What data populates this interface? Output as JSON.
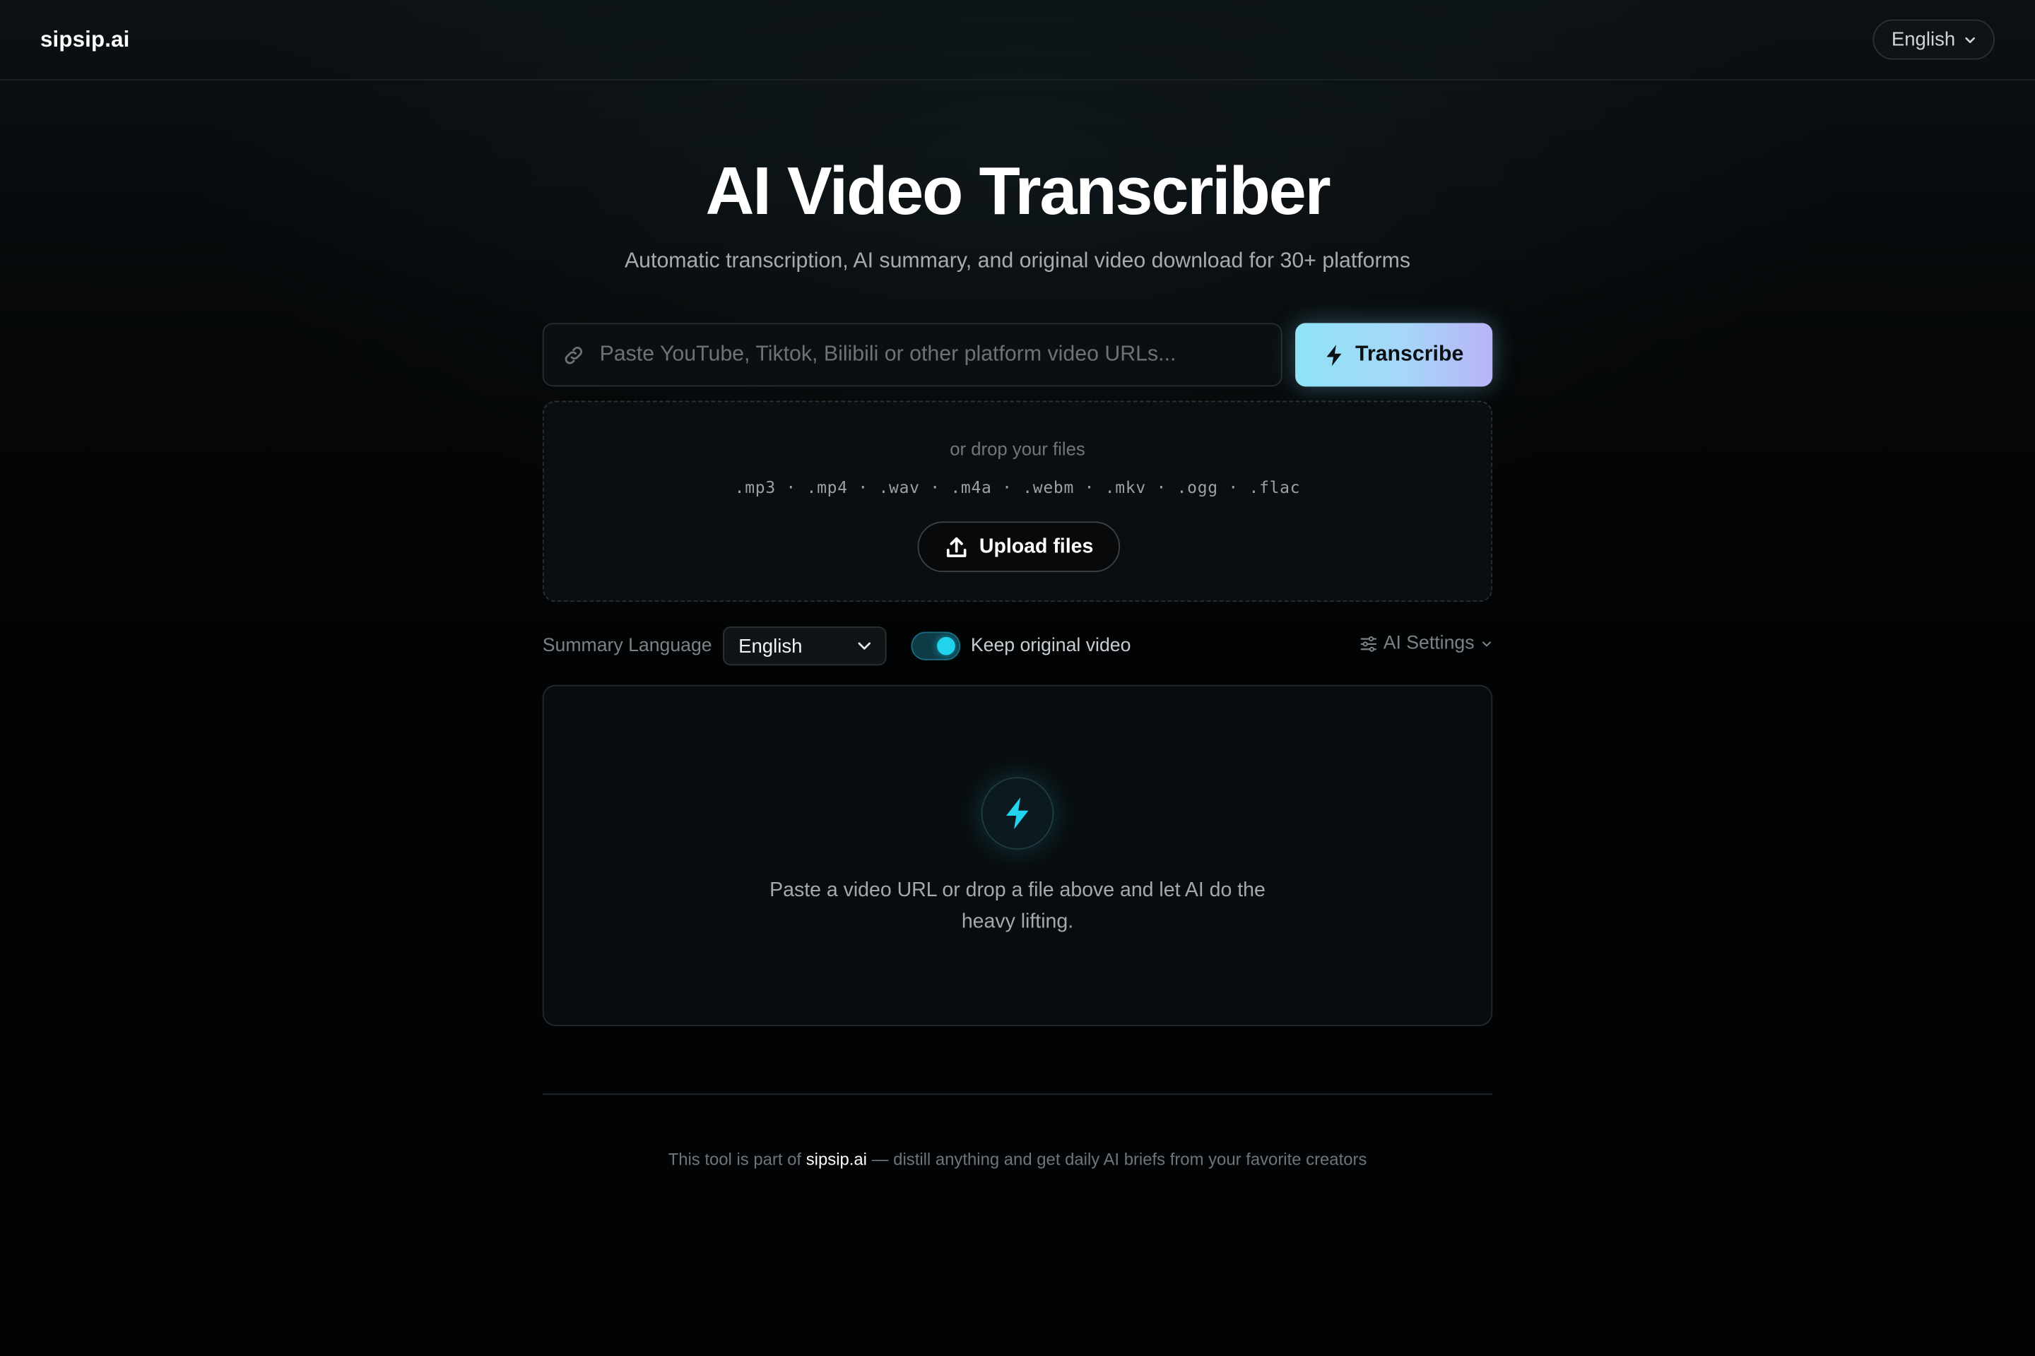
{
  "header": {
    "brand": "sipsip.ai",
    "language": "English"
  },
  "hero": {
    "title": "AI Video Transcriber",
    "subtitle": "Automatic transcription, AI summary, and original video download for 30+ platforms"
  },
  "url_input": {
    "value": "",
    "placeholder": "Paste YouTube, Tiktok, Bilibili or other platform video URLs..."
  },
  "transcribe_button": {
    "label": "Transcribe"
  },
  "dropzone": {
    "hint": "or drop your files",
    "formats": ".mp3 · .mp4 · .wav · .m4a · .webm · .mkv · .ogg · .flac",
    "upload_label": "Upload files"
  },
  "options": {
    "summary_language_label": "Summary Language",
    "summary_language_value": "English",
    "keep_original_label": "Keep original video",
    "keep_original_on": true,
    "ai_settings_label": "AI Settings"
  },
  "empty_state": {
    "message": "Paste a video URL or drop a file above and let AI do the heavy lifting."
  },
  "footer": {
    "prefix": "This tool is part of",
    "link": "sipsip.ai",
    "suffix": "— distill anything and get daily AI briefs from your favorite creators"
  },
  "colors": {
    "accent_cyan": "#22d3ee",
    "button_gradient_start": "#8fe3f5",
    "button_gradient_end": "#b9b4f8",
    "background": "#020304"
  },
  "icons": {
    "language_chevron": "chevron-down-icon",
    "url_field": "link-icon",
    "transcribe": "bolt-icon",
    "upload": "upload-icon",
    "select_chevron": "chevron-down-icon",
    "ai_settings": "sliders-icon",
    "empty_state": "bolt-icon"
  }
}
